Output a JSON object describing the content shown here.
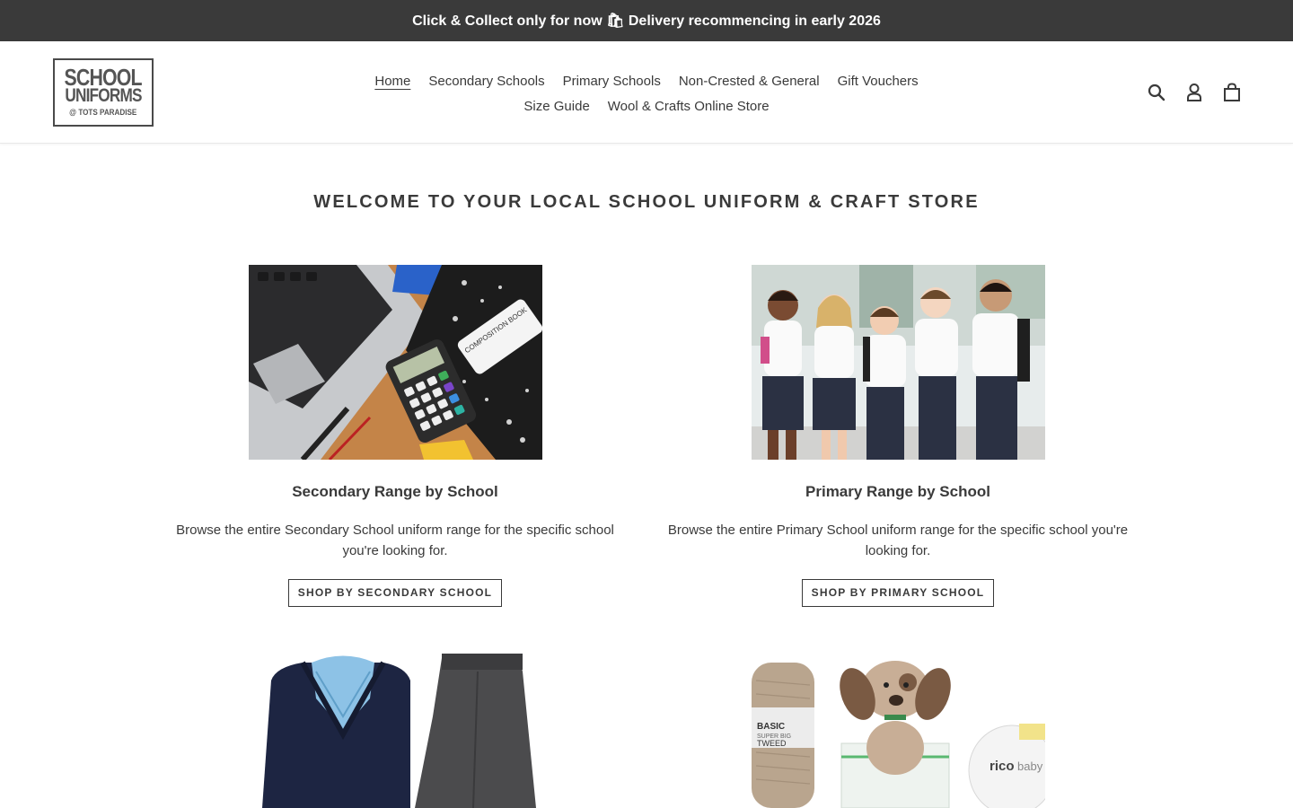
{
  "announcement": {
    "text": "Click & Collect only for now 🛍 Delivery recommencing in early 2026"
  },
  "logo": {
    "line1": "SCHOOL",
    "line2": "UNIFORMS",
    "line3": "@ TOTS PARADISE"
  },
  "nav": {
    "items": [
      {
        "label": "Home",
        "active": true
      },
      {
        "label": "Secondary Schools"
      },
      {
        "label": "Primary Schools"
      },
      {
        "label": "Non-Crested & General"
      },
      {
        "label": "Gift Vouchers"
      },
      {
        "label": "Size Guide"
      },
      {
        "label": "Wool & Crafts Online Store"
      }
    ]
  },
  "header_icons": [
    "search-icon",
    "account-icon",
    "cart-icon"
  ],
  "main": {
    "heading": "WELCOME TO YOUR LOCAL SCHOOL UNIFORM & CRAFT STORE",
    "cards": [
      {
        "title": "Secondary Range by School",
        "description": "Browse the entire Secondary School uniform range for the specific school you're looking for.",
        "button": "SHOP BY SECONDARY SCHOOL",
        "image_text": "COMPOSITION BOOK"
      },
      {
        "title": "Primary Range by School",
        "description": "Browse the entire Primary School uniform range for the specific school you're looking for.",
        "button": "SHOP BY PRIMARY SCHOOL"
      },
      {},
      {
        "image_text_1": "BASIC",
        "image_text_2": "SUPER BIG",
        "image_text_3": "TWEED",
        "image_text_4": "rico",
        "image_text_5": "baby"
      }
    ]
  },
  "colors": {
    "announcement_bg": "#3a3a3a",
    "text": "#3a3a3a",
    "background": "#ffffff"
  }
}
